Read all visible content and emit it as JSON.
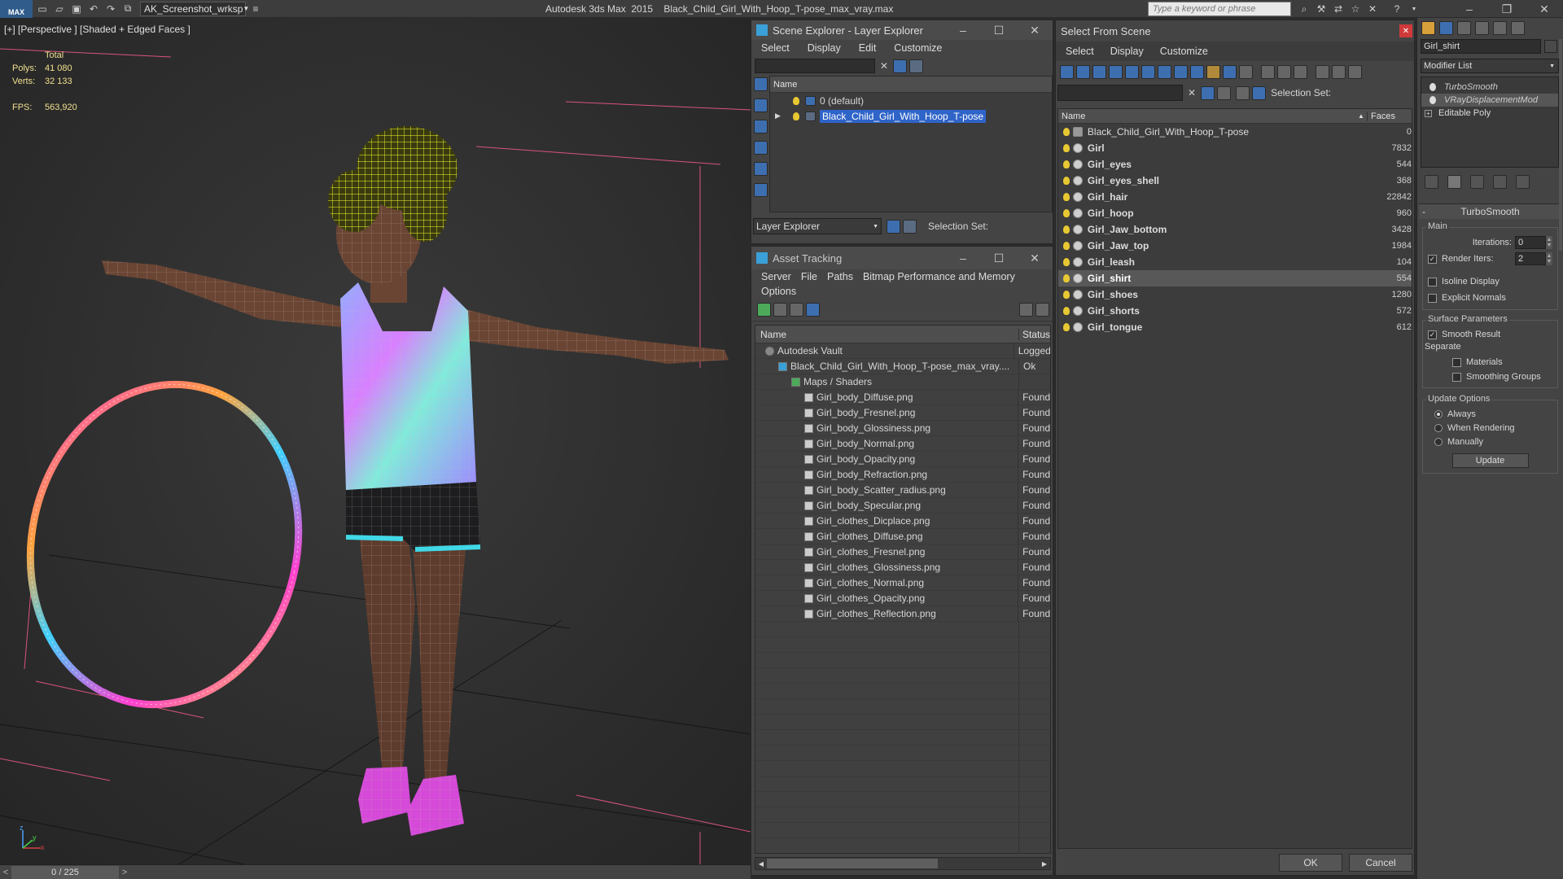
{
  "app": {
    "title": "Autodesk 3ds Max  2015    Black_Child_Girl_With_Hoop_T-pose_max_vray.max",
    "workspace": "AK_Screenshot_wrksp",
    "search_placeholder": "Type a keyword or phrase",
    "logo_text": "MAX"
  },
  "viewport": {
    "label": "[+] [Perspective ] [Shaded + Edged Faces ]",
    "stats": {
      "total_label": "Total",
      "polys_label": "Polys:",
      "polys_value": "41 080",
      "verts_label": "Verts:",
      "verts_value": "32 133",
      "fps_label": "FPS:",
      "fps_value": "563,920"
    },
    "axis": {
      "x": "x",
      "y": "y",
      "z": "z"
    }
  },
  "timeline": {
    "frame": "0 / 225",
    "prev": "<",
    "next": ">"
  },
  "scene_explorer": {
    "title": "Scene Explorer - Layer Explorer",
    "menu": [
      "Select",
      "Display",
      "Edit",
      "Customize"
    ],
    "column": "Name",
    "rows": [
      {
        "name": "0 (default)",
        "selected": false
      },
      {
        "name": "Black_Child_Girl_With_Hoop_T-pose",
        "selected": true
      }
    ],
    "footer_dropdown": "Layer Explorer",
    "selection_set_label": "Selection Set:"
  },
  "asset_tracking": {
    "title": "Asset Tracking",
    "menu": [
      "Server",
      "File",
      "Paths",
      "Bitmap Performance and Memory"
    ],
    "menu2": [
      "Options"
    ],
    "col_name": "Name",
    "col_status": "Status",
    "rows": [
      {
        "name": "Autodesk Vault",
        "status": "Logged",
        "indent": 0,
        "icon": "vault"
      },
      {
        "name": "Black_Child_Girl_With_Hoop_T-pose_max_vray....",
        "status": "Ok",
        "indent": 1,
        "icon": "max"
      },
      {
        "name": "Maps / Shaders",
        "status": "",
        "indent": 2,
        "icon": "maps"
      },
      {
        "name": "Girl_body_Diffuse.png",
        "status": "Found",
        "indent": 3,
        "icon": "png"
      },
      {
        "name": "Girl_body_Fresnel.png",
        "status": "Found",
        "indent": 3,
        "icon": "png"
      },
      {
        "name": "Girl_body_Glossiness.png",
        "status": "Found",
        "indent": 3,
        "icon": "png"
      },
      {
        "name": "Girl_body_Normal.png",
        "status": "Found",
        "indent": 3,
        "icon": "png"
      },
      {
        "name": "Girl_body_Opacity.png",
        "status": "Found",
        "indent": 3,
        "icon": "png"
      },
      {
        "name": "Girl_body_Refraction.png",
        "status": "Found",
        "indent": 3,
        "icon": "png"
      },
      {
        "name": "Girl_body_Scatter_radius.png",
        "status": "Found",
        "indent": 3,
        "icon": "png"
      },
      {
        "name": "Girl_body_Specular.png",
        "status": "Found",
        "indent": 3,
        "icon": "png"
      },
      {
        "name": "Girl_clothes_Dicplace.png",
        "status": "Found",
        "indent": 3,
        "icon": "png"
      },
      {
        "name": "Girl_clothes_Diffuse.png",
        "status": "Found",
        "indent": 3,
        "icon": "png"
      },
      {
        "name": "Girl_clothes_Fresnel.png",
        "status": "Found",
        "indent": 3,
        "icon": "png"
      },
      {
        "name": "Girl_clothes_Glossiness.png",
        "status": "Found",
        "indent": 3,
        "icon": "png"
      },
      {
        "name": "Girl_clothes_Normal.png",
        "status": "Found",
        "indent": 3,
        "icon": "png"
      },
      {
        "name": "Girl_clothes_Opacity.png",
        "status": "Found",
        "indent": 3,
        "icon": "png"
      },
      {
        "name": "Girl_clothes_Reflection.png",
        "status": "Found",
        "indent": 3,
        "icon": "png"
      }
    ]
  },
  "select_from_scene": {
    "title": "Select From Scene",
    "menu": [
      "Select",
      "Display",
      "Customize"
    ],
    "selection_set_label": "Selection Set:",
    "col_name": "Name",
    "col_faces": "Faces",
    "rows": [
      {
        "name": "Black_Child_Girl_With_Hoop_T-pose",
        "faces": "0",
        "bold": false,
        "selected": false
      },
      {
        "name": "Girl",
        "faces": "7832",
        "bold": true,
        "selected": false
      },
      {
        "name": "Girl_eyes",
        "faces": "544",
        "bold": true,
        "selected": false
      },
      {
        "name": "Girl_eyes_shell",
        "faces": "368",
        "bold": true,
        "selected": false
      },
      {
        "name": "Girl_hair",
        "faces": "22842",
        "bold": true,
        "selected": false
      },
      {
        "name": "Girl_hoop",
        "faces": "960",
        "bold": true,
        "selected": false
      },
      {
        "name": "Girl_Jaw_bottom",
        "faces": "3428",
        "bold": true,
        "selected": false
      },
      {
        "name": "Girl_Jaw_top",
        "faces": "1984",
        "bold": true,
        "selected": false
      },
      {
        "name": "Girl_leash",
        "faces": "104",
        "bold": true,
        "selected": false
      },
      {
        "name": "Girl_shirt",
        "faces": "554",
        "bold": true,
        "selected": true
      },
      {
        "name": "Girl_shoes",
        "faces": "1280",
        "bold": true,
        "selected": false
      },
      {
        "name": "Girl_shorts",
        "faces": "572",
        "bold": true,
        "selected": false
      },
      {
        "name": "Girl_tongue",
        "faces": "612",
        "bold": true,
        "selected": false
      }
    ],
    "ok": "OK",
    "cancel": "Cancel"
  },
  "command_panel": {
    "object_name": "Girl_shirt",
    "modifier_list": "Modifier List",
    "stack": [
      "TurboSmooth",
      "VRayDisplacementMod",
      "Editable Poly"
    ],
    "rollout_title": "TurboSmooth",
    "main_label": "Main",
    "iterations_label": "Iterations:",
    "iterations_value": "0",
    "render_iters_label": "Render Iters:",
    "render_iters_value": "2",
    "isoline_label": "Isoline Display",
    "explicit_normals_label": "Explicit Normals",
    "surface_params_label": "Surface Parameters",
    "smooth_result_label": "Smooth Result",
    "separate_label": "Separate",
    "materials_label": "Materials",
    "smoothing_groups_label": "Smoothing Groups",
    "update_options_label": "Update Options",
    "always_label": "Always",
    "when_rendering_label": "When Rendering",
    "manually_label": "Manually",
    "update_button": "Update"
  }
}
